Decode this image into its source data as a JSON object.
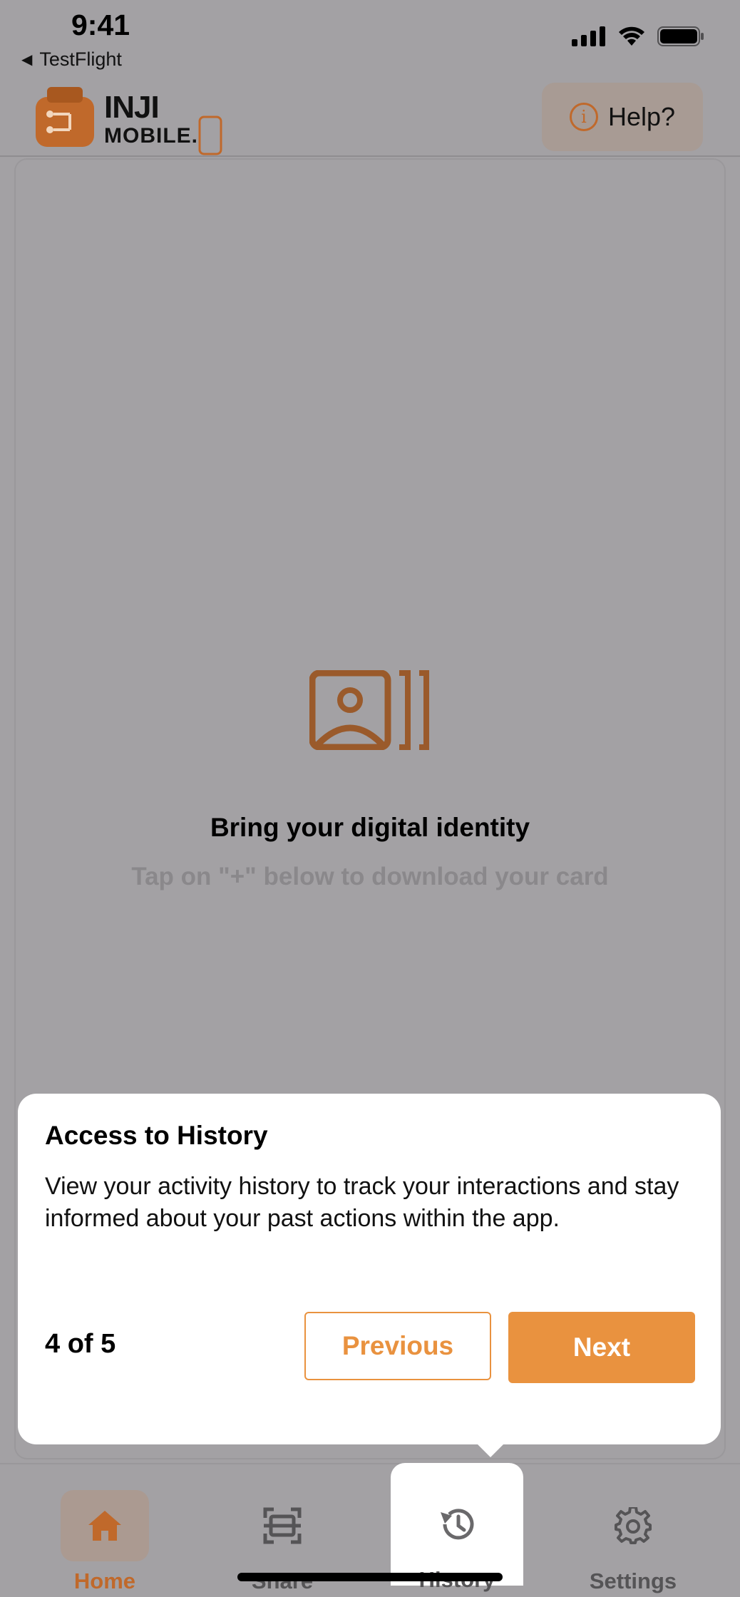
{
  "status_bar": {
    "time": "9:41",
    "back_app": "TestFlight"
  },
  "header": {
    "logo_line1": "INJI",
    "logo_line2": "MOBILE.",
    "help_label": "Help?",
    "help_icon": "info-icon"
  },
  "empty_state": {
    "icon": "id-card-stack-icon",
    "title": "Bring your digital identity",
    "subtitle": "Tap on  \"+\" below to download your card"
  },
  "tooltip": {
    "title": "Access to History",
    "description": "View your activity history to track your interactions and stay informed about your past actions within the app.",
    "step": "4 of 5",
    "previous_label": "Previous",
    "next_label": "Next"
  },
  "tabbar": {
    "items": [
      {
        "label": "Home",
        "icon": "home-icon",
        "active": true
      },
      {
        "label": "Share",
        "icon": "scan-icon",
        "active": false
      },
      {
        "label": "History",
        "icon": "history-icon",
        "active": false,
        "highlighted": true
      },
      {
        "label": "Settings",
        "icon": "gear-icon",
        "active": false
      }
    ]
  },
  "colors": {
    "accent": "#e9923f",
    "brand_dark": "#c0692b",
    "overlay_bg": "#a3a1a4"
  }
}
